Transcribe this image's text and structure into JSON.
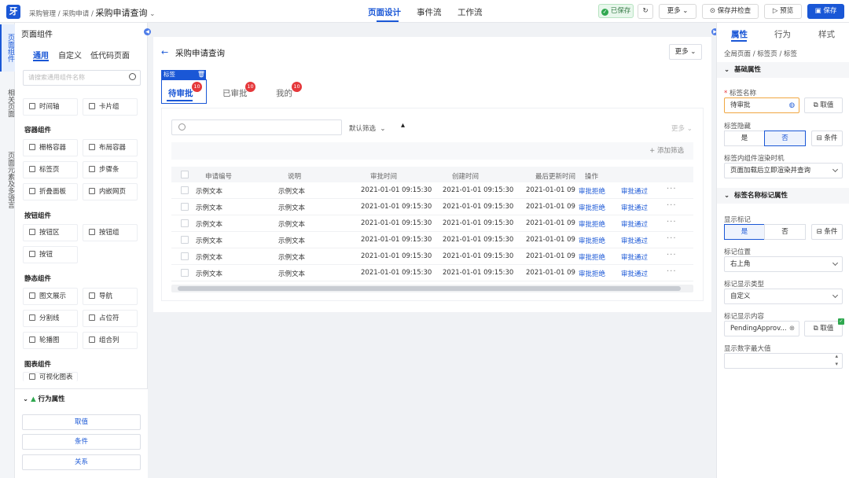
{
  "topbar": {
    "logo": "牙",
    "breadcrumb_prefix": "采购管理 / 采购申请 /",
    "page_name": "采购申请查询",
    "tabs": [
      "页面设计",
      "事件流",
      "工作流"
    ],
    "saved": "已保存",
    "more": "更多",
    "save_check": "保存并检查",
    "preview": "预览",
    "save": "保存"
  },
  "rail": [
    "页面组件",
    "相关页面",
    "页面元素及多语言"
  ],
  "left": {
    "title": "页面组件",
    "tabs": [
      "通用",
      "自定义",
      "低代码页面"
    ],
    "search_placeholder": "请搜索通用组件名称",
    "row0": [
      "时间轴",
      "卡片组"
    ],
    "groups": [
      {
        "name": "容器组件",
        "items": [
          "栅格容器",
          "布局容器",
          "标签页",
          "步骤条",
          "折叠面板",
          "内嵌网页"
        ]
      },
      {
        "name": "按钮组件",
        "items": [
          "按钮区",
          "按钮组",
          "按钮"
        ]
      },
      {
        "name": "静态组件",
        "items": [
          "图文展示",
          "导航",
          "分割线",
          "占位符",
          "轮播图",
          "组合列"
        ]
      },
      {
        "name": "图表组件",
        "items": [
          "可视化图表"
        ]
      }
    ],
    "behavior": {
      "title": "行为属性",
      "buttons": [
        "取值",
        "条件",
        "关系"
      ]
    }
  },
  "canvas": {
    "title": "采购申请查询",
    "more": "更多",
    "tag_label": "标签",
    "tabs": [
      {
        "label": "待审批",
        "badge": "10"
      },
      {
        "label": "已审批",
        "badge": "10"
      },
      {
        "label": "我的",
        "badge": "10"
      }
    ],
    "default_filter": "默认筛选",
    "more2": "更多",
    "add_filter": "+ 添加筛选",
    "columns": [
      "申请编号",
      "说明",
      "审批时间",
      "创建时间",
      "最后更新时间",
      "操作"
    ],
    "rows": [
      [
        "示例文本",
        "示例文本",
        "2021-01-01 09:15:30",
        "2021-01-01 09:15:30",
        "2021-01-01 09"
      ],
      [
        "示例文本",
        "示例文本",
        "2021-01-01 09:15:30",
        "2021-01-01 09:15:30",
        "2021-01-01 09"
      ],
      [
        "示例文本",
        "示例文本",
        "2021-01-01 09:15:30",
        "2021-01-01 09:15:30",
        "2021-01-01 09"
      ],
      [
        "示例文本",
        "示例文本",
        "2021-01-01 09:15:30",
        "2021-01-01 09:15:30",
        "2021-01-01 09"
      ],
      [
        "示例文本",
        "示例文本",
        "2021-01-01 09:15:30",
        "2021-01-01 09:15:30",
        "2021-01-01 09"
      ],
      [
        "示例文本",
        "示例文本",
        "2021-01-01 09:15:30",
        "2021-01-01 09:15:30",
        "2021-01-01 09"
      ]
    ],
    "action_reject": "审批拒绝",
    "action_approve": "审批通过"
  },
  "right": {
    "tabs": [
      "属性",
      "行为",
      "样式"
    ],
    "crumb": "全局页面  /  标签页  /  标签",
    "sec_basic": "基础属性",
    "tag_name_label": "标签名称",
    "tag_name_value": "待审批",
    "take_value": "取值",
    "hide_label": "标签隐藏",
    "yes": "是",
    "no": "否",
    "condition": "条件",
    "render_label": "标签内组件渲染时机",
    "render_value": "页面加载后立即渲染并查询",
    "sec_mark": "标签名称标记属性",
    "show_mark_label": "显示标记",
    "mark_pos_label": "标记位置",
    "mark_pos_value": "右上角",
    "mark_type_label": "标记显示类型",
    "mark_type_value": "自定义",
    "mark_content_label": "标记显示内容",
    "mark_content_value": "PendingApprov...",
    "max_label": "显示数字最大值"
  }
}
